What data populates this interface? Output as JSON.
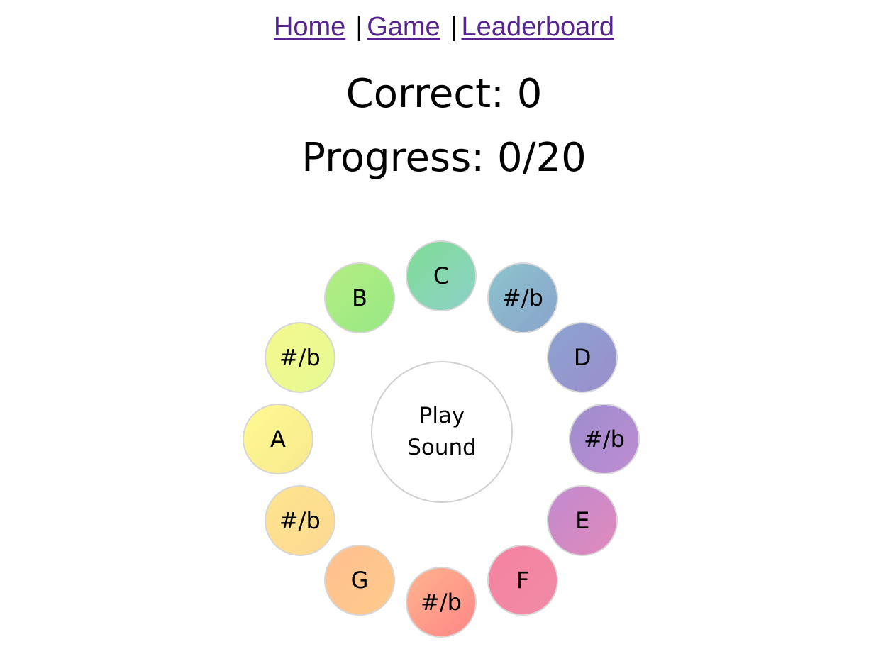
{
  "nav": {
    "links": [
      {
        "label": "Home"
      },
      {
        "label": "Game"
      },
      {
        "label": "Leaderboard"
      }
    ],
    "separator": "|"
  },
  "score": {
    "correct_label": "Correct: 0",
    "progress_label": "Progress: 0/20"
  },
  "play_button": {
    "line1": "Play",
    "line2": "Sound"
  },
  "notes": [
    {
      "label": "C",
      "colors": [
        "#7fdd95",
        "#8dd0c8"
      ]
    },
    {
      "label": "#/b",
      "colors": [
        "#8cc4cb",
        "#8aa3cc"
      ]
    },
    {
      "label": "D",
      "colors": [
        "#8aa3cf",
        "#9c8ecc"
      ]
    },
    {
      "label": "#/b",
      "colors": [
        "#9c8ecf",
        "#c08bd0"
      ]
    },
    {
      "label": "E",
      "colors": [
        "#c08bd0",
        "#e089ba"
      ]
    },
    {
      "label": "F",
      "colors": [
        "#f583a0",
        "#f08aa6"
      ]
    },
    {
      "label": "#/b",
      "colors": [
        "#ffb48e",
        "#ff8686"
      ]
    },
    {
      "label": "G",
      "colors": [
        "#ffbf90",
        "#fecb8c"
      ]
    },
    {
      "label": "#/b",
      "colors": [
        "#fee48f",
        "#fcd990"
      ]
    },
    {
      "label": "A",
      "colors": [
        "#fffa92",
        "#f7e88e"
      ]
    },
    {
      "label": "#/b",
      "colors": [
        "#f4f98d",
        "#e6f993"
      ]
    },
    {
      "label": "B",
      "colors": [
        "#b3ee82",
        "#98e884"
      ]
    }
  ]
}
